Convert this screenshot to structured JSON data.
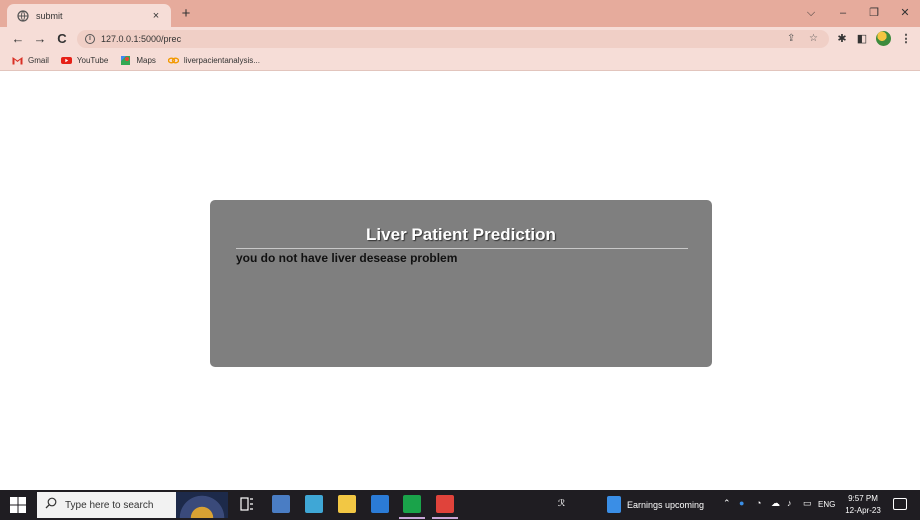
{
  "browser": {
    "tab_title": "submit",
    "tab_close": "×",
    "new_tab": "+",
    "url": "127.0.0.1:5000/prec",
    "window_controls": {
      "dropdown": "⌵",
      "minimize": "–",
      "restore": "❐",
      "close": "✕"
    },
    "nav": {
      "back": "←",
      "forward": "→",
      "reload": "C"
    },
    "bookmarks": [
      {
        "label": "Gmail",
        "icon": "gmail-icon"
      },
      {
        "label": "YouTube",
        "icon": "youtube-icon"
      },
      {
        "label": "Maps",
        "icon": "maps-icon"
      },
      {
        "label": "liverpacientanalysis...",
        "icon": "link-icon"
      }
    ]
  },
  "page": {
    "title": "Liver Patient Prediction",
    "message": "you do not have liver desease problem"
  },
  "taskbar": {
    "search_placeholder": "Type here to search",
    "news": "Earnings upcoming",
    "lang": "ENG",
    "time": "9:57 PM",
    "date": "12-Apr-23",
    "colors": {
      "background": "#1f1d22",
      "accent": "#c9a7d8"
    }
  }
}
